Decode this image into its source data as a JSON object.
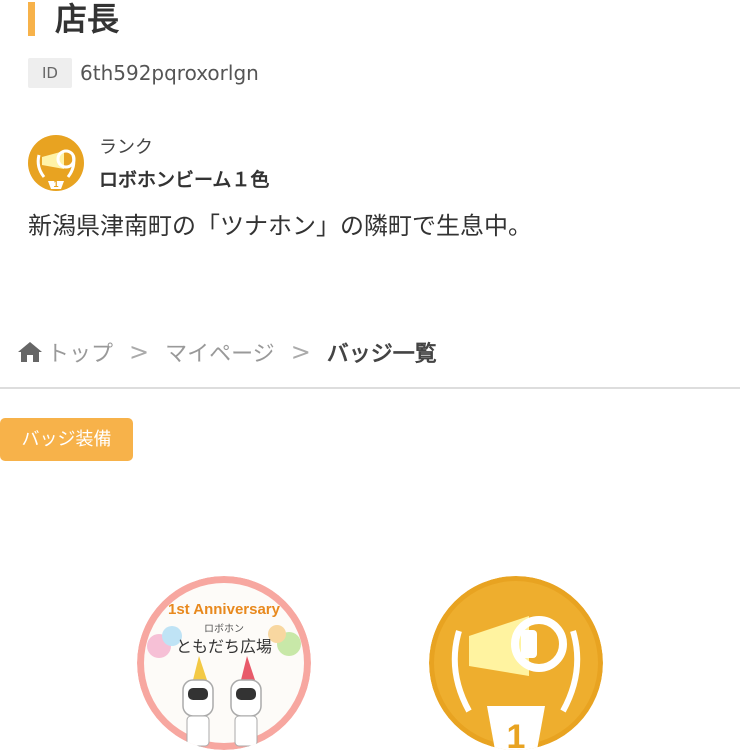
{
  "profile": {
    "name": "店長",
    "id_label": "ID",
    "id_value": "6th592pqroxorlgn",
    "rank_label": "ランク",
    "rank_name": "ロボホンビーム１色",
    "bio": "新潟県津南町の「ツナホン」の隣町で生息中。"
  },
  "breadcrumb": {
    "items": [
      "トップ",
      "マイページ",
      "バッジ一覧"
    ],
    "separator": ">"
  },
  "actions": {
    "equip_badge_label": "バッジ装備"
  },
  "badges": [
    {
      "name": "anniversary-badge",
      "text_anniversary": "1st Anniversary",
      "text_robohon": "ロボホン",
      "text_plaza": "ともだち広場"
    },
    {
      "name": "rank-badge",
      "text_number": "1"
    }
  ],
  "colors": {
    "accent": "#f7b24a",
    "gold": "#e8a321",
    "text": "#333333"
  },
  "icons": [
    "home-icon",
    "rank-medal-icon"
  ]
}
